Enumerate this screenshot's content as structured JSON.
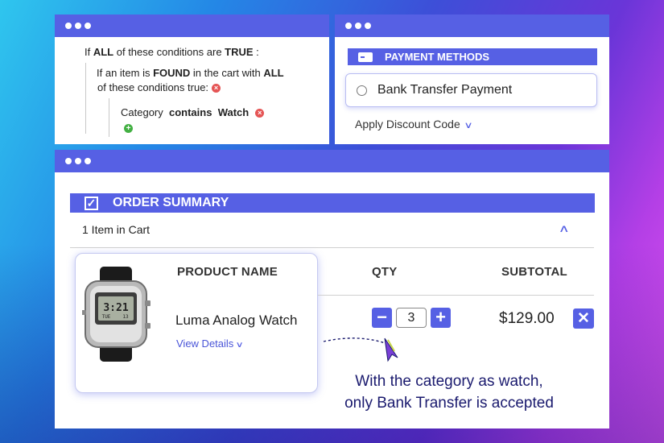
{
  "conditions_window": {
    "line1": {
      "pre": "If ",
      "all": "ALL",
      "mid": " of these conditions are ",
      "true": "TRUE",
      "post": " :"
    },
    "line2": {
      "pre": "If an item is ",
      "found": "FOUND",
      "mid": " in the cart with ",
      "all": "ALL"
    },
    "line3": "of these conditions true:",
    "line4": {
      "attribute": "Category",
      "operator": "contains",
      "value": "Watch"
    }
  },
  "payment_window": {
    "header": "PAYMENT METHODS",
    "option": "Bank Transfer Payment",
    "discount": "Apply Discount Code"
  },
  "order_window": {
    "header": "ORDER SUMMARY",
    "items_in_cart": "1 Item in Cart",
    "columns": {
      "product": "PRODUCT NAME",
      "qty": "QTY",
      "subtotal": "SUBTOTAL"
    },
    "product": {
      "name": "Luma Analog Watch",
      "view_details": "View Details",
      "qty": "3",
      "subtotal": "$129.00",
      "watch_display": {
        "time": "3:21",
        "day": "TUE",
        "date": "13"
      }
    },
    "note_line1": "With the category as watch,",
    "note_line2": "only Bank Transfer is accepted"
  },
  "colors": {
    "accent": "#5660e4",
    "note_text": "#1a1a6e"
  },
  "icons": [
    "card-icon",
    "radio",
    "chevron-down-icon",
    "chevron-up-icon",
    "check-icon",
    "minus-icon",
    "plus-icon",
    "close-icon",
    "remove-condition-icon",
    "add-condition-icon",
    "cursor-icon"
  ]
}
